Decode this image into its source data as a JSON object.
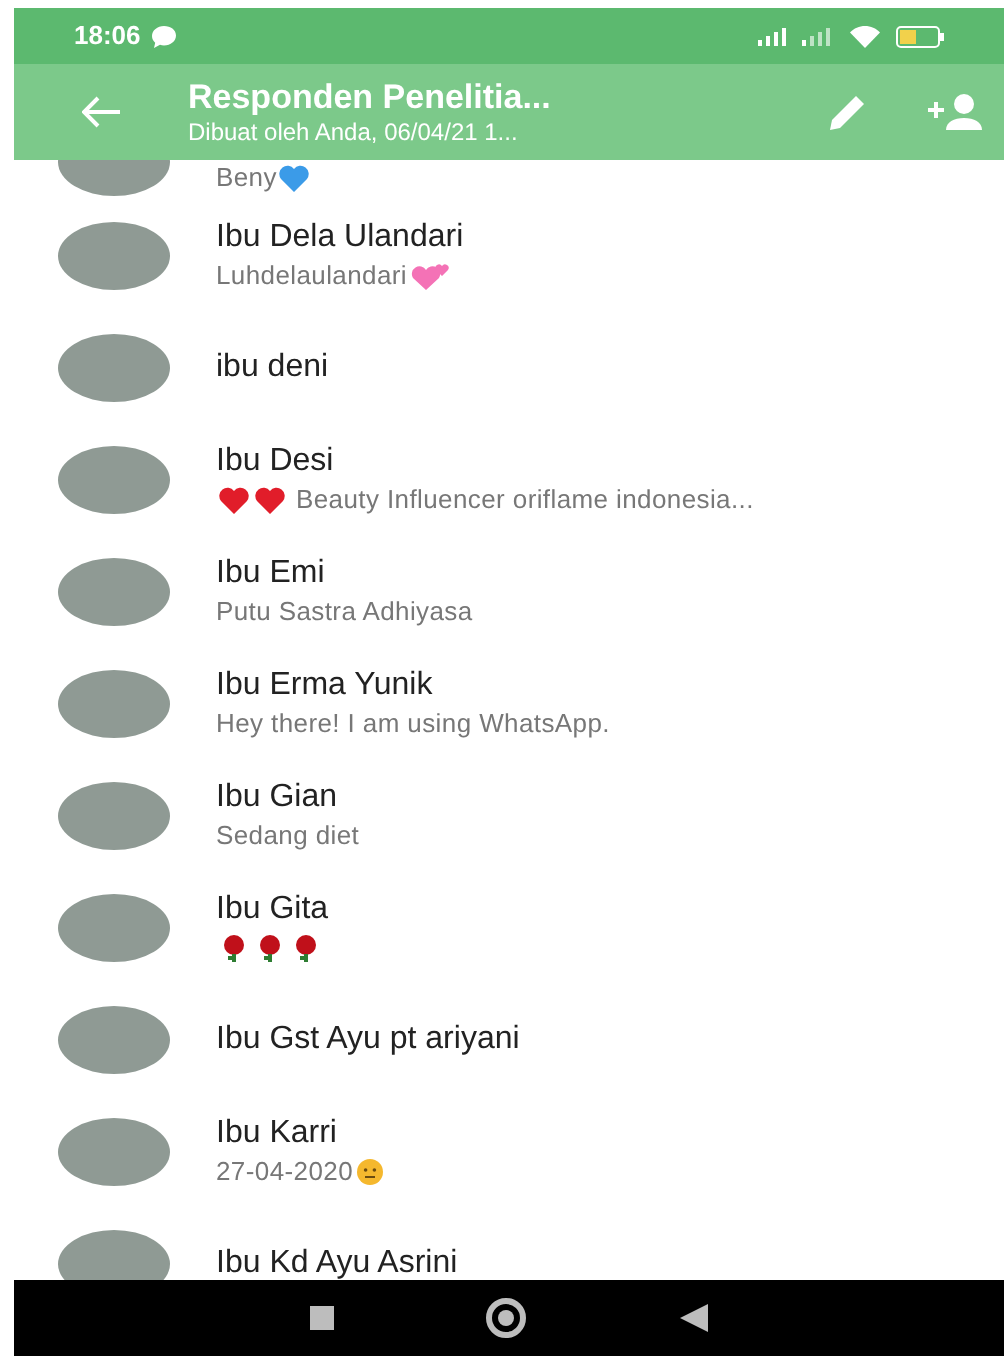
{
  "status_bar": {
    "time": "18:06"
  },
  "header": {
    "title": "Responden Penelitia...",
    "subtitle": "Dibuat oleh Anda, 06/04/21 1..."
  },
  "participants": [
    {
      "status": "Beny",
      "status_icons_after": [
        {
          "kind": "heart",
          "color": "#3b9be8"
        }
      ]
    },
    {
      "name": "Ibu Dela Ulandari",
      "status": "Luhdelaulandari",
      "status_icons_after": [
        {
          "kind": "hearts",
          "color": "#f472b6"
        }
      ]
    },
    {
      "name": "ibu deni"
    },
    {
      "name": "Ibu Desi",
      "status": "Beauty Influencer oriflame indonesia...",
      "status_icons_before": [
        {
          "kind": "heart",
          "color": "#e11d2a"
        },
        {
          "kind": "heart",
          "color": "#e11d2a"
        }
      ]
    },
    {
      "name": "Ibu Emi",
      "status": "Putu Sastra Adhiyasa"
    },
    {
      "name": "Ibu Erma Yunik",
      "status": "Hey there! I am using WhatsApp."
    },
    {
      "name": "Ibu Gian",
      "status": "Sedang diet"
    },
    {
      "name": "Ibu Gita",
      "status_icons_before": [
        {
          "kind": "rose",
          "color": "#c0101a"
        },
        {
          "kind": "rose",
          "color": "#c0101a"
        },
        {
          "kind": "rose",
          "color": "#c0101a"
        }
      ]
    },
    {
      "name": "Ibu Gst Ayu pt ariyani"
    },
    {
      "name": "Ibu Karri",
      "status": "27-04-2020",
      "status_icons_after": [
        {
          "kind": "smiley",
          "color": "#f5b82e"
        }
      ]
    },
    {
      "name": "Ibu Kd Ayu Asrini"
    }
  ]
}
